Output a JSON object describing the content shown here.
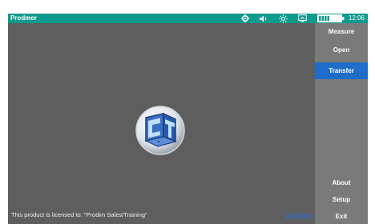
{
  "titlebar": {
    "app_title": "Prodmer",
    "clock": "12:06",
    "icons": [
      "settings-gear-icon",
      "volume-icon",
      "brightness-icon",
      "screen-icon",
      "battery-icon"
    ]
  },
  "canvas": {
    "license_text": "This product is licensed to: \"Prodim Sales/Training\"",
    "disclaimer_link": "Disclaimer"
  },
  "sidebar": {
    "top_items": [
      {
        "label": "Measure",
        "active": false
      },
      {
        "label": "Open",
        "active": false
      },
      {
        "label": "Transfer",
        "active": true
      }
    ],
    "bottom_items": [
      {
        "label": "About"
      },
      {
        "label": "Setup"
      },
      {
        "label": "Exit"
      }
    ]
  },
  "colors": {
    "titlebar": "#0f9a8e",
    "background": "#5e5e5e",
    "sidebar": "#7a7a7a",
    "active_button": "#1e6ec9",
    "link": "#2d6fd6"
  }
}
